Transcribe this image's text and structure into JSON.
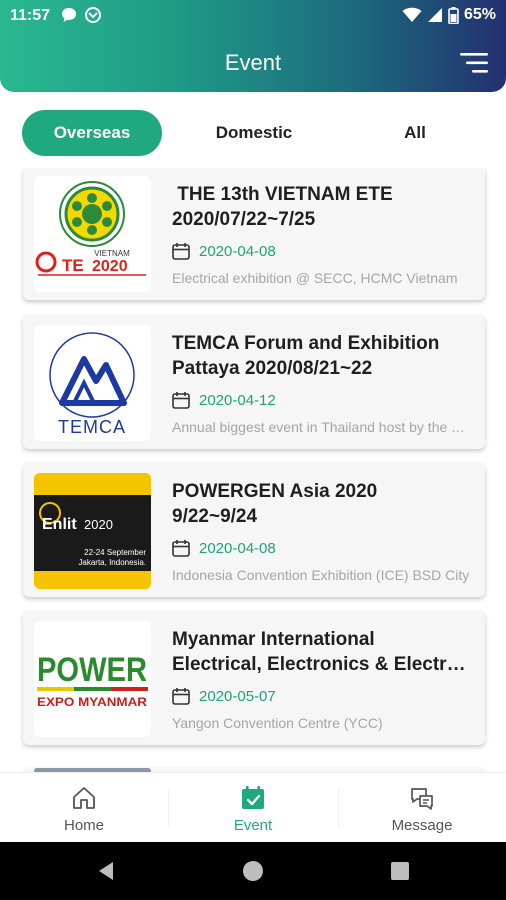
{
  "status_bar": {
    "time": "11:57",
    "battery": "65%"
  },
  "header": {
    "title": "Event",
    "menu_icon": "filter-menu-icon",
    "gradient_colors": [
      "#2ab890",
      "#23306f"
    ]
  },
  "tabs": [
    {
      "label": "Overseas",
      "active": true
    },
    {
      "label": "Domestic",
      "active": false
    },
    {
      "label": "All",
      "active": false
    }
  ],
  "events": [
    {
      "title": " THE 13th VIETNAM ETE\n2020/07/22~7/25",
      "date": "2020-04-08",
      "description": "Electrical exhibition @ SECC, HCMC Vietnam",
      "logo_text": "VIETNAM ETE 2020"
    },
    {
      "title": "TEMCA Forum and Exhibition\nPattaya 2020/08/21~22",
      "date": "2020-04-12",
      "description": "Annual biggest event in Thailand host by the TEMCA",
      "logo_text": "TEMCA"
    },
    {
      "title": "POWERGEN Asia 2020\n9/22~9/24",
      "date": "2020-04-08",
      "description": "Indonesia Convention Exhibition (ICE) BSD City",
      "logo_text": "Enlit 2020",
      "logo_subtext": "22-24 September\nJakarta, Indonesia"
    },
    {
      "title": "Myanmar International\nElectrical, Electronics & Electr…",
      "date": "2020-05-07",
      "description": "Yangon Convention Centre (YCC)",
      "logo_text": "POWER",
      "logo_subtext": "EXPO MYANMAR"
    }
  ],
  "bottom_nav": [
    {
      "label": "Home",
      "icon": "home-icon",
      "active": false
    },
    {
      "label": "Event",
      "icon": "calendar-check-icon",
      "active": true
    },
    {
      "label": "Message",
      "icon": "chat-bubbles-icon",
      "active": false
    }
  ],
  "colors": {
    "accent": "#20a87e",
    "date_text": "#1fa377",
    "desc_text": "#a5a5a5"
  }
}
